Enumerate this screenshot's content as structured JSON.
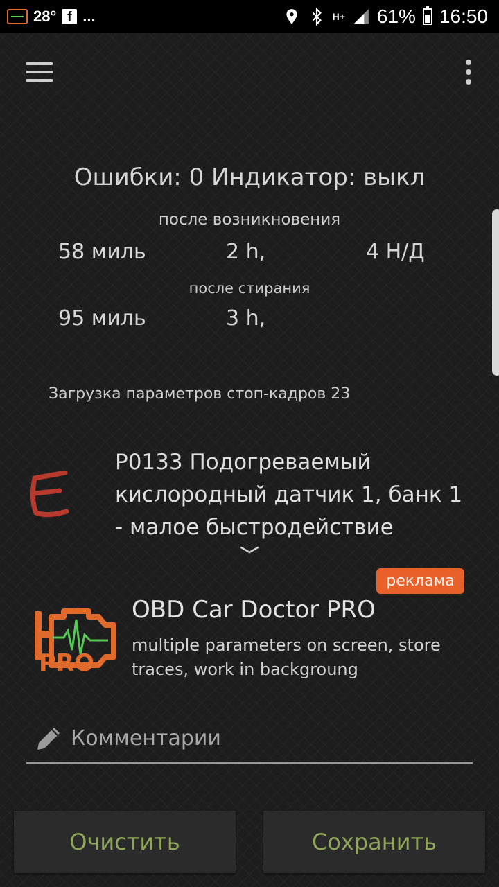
{
  "statusbar": {
    "temperature": "28°",
    "facebook": "f",
    "more": "...",
    "network": "H+",
    "battery": "61%",
    "time": "16:50"
  },
  "summary": {
    "title": "Ошибки: 0 Индикатор: выкл",
    "since_occurrence_label": "после возникновения",
    "since_occurrence": {
      "distance": "58 миль",
      "time": "2 h,",
      "extra": "4 Н/Д"
    },
    "since_clear_label": "после стирания",
    "since_clear": {
      "distance": "95 миль",
      "time": "3 h,"
    },
    "freeze_frame": "Загрузка параметров стоп-кадров 23"
  },
  "dtc": {
    "lines": [
      "P0133 Подогреваемый",
      "кислородный датчик 1, банк 1",
      "- малое быстродействие"
    ],
    "icon_color": "#b83a2e"
  },
  "ad": {
    "badge": "реклама",
    "title": "OBD Car Doctor PRO",
    "description": "multiple parameters on screen, store traces, work in backgroung",
    "logo_text": "PRO",
    "badge_color": "#e8602a"
  },
  "comment": {
    "placeholder": "Комментарии"
  },
  "buttons": {
    "clear": "Очистить",
    "save": "Сохранить",
    "color": "#8fa65a"
  }
}
